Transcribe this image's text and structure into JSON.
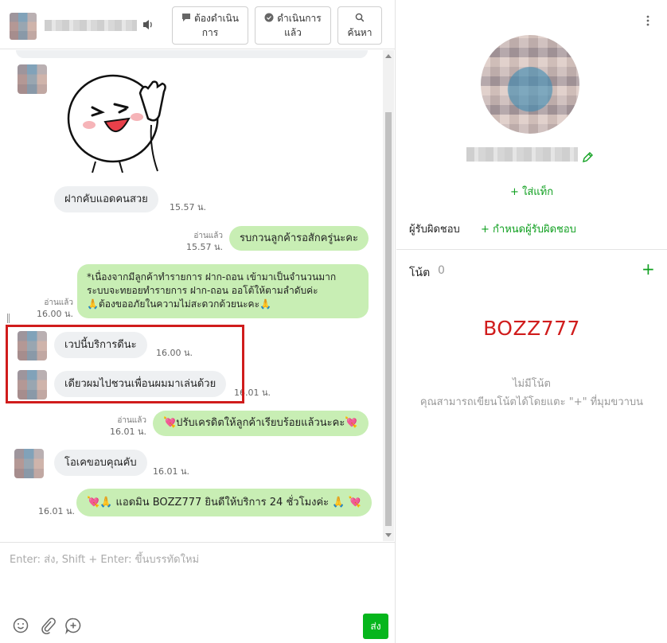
{
  "header": {
    "pending_label": "ต้องดำเนินการ",
    "done_label": "ดำเนินการแล้ว",
    "search_label": "ค้นหา"
  },
  "messages": {
    "m1": {
      "text": "ฝากคับแอดคนสวย",
      "time": "15.57 น."
    },
    "m2": {
      "text": "รบกวนลูกค้ารอสักครู่นะคะ",
      "read": "อ่านแล้ว",
      "time": "15.57 น."
    },
    "m3": {
      "line1": "*เนื่องจากมีลูกค้าทำรายการ  ฝาก-ถอน เข้ามาเป็นจำนวนมาก",
      "line2": "ระบบจะทยอยทำรายการ  ฝาก-ถอน ออโต้ให้ตามลำดับค่ะ",
      "line3": "🙏ต้องขออภัยในความไม่สะดวกด้วยนะคะ🙏",
      "read": "อ่านแล้ว",
      "time": "16.00 น."
    },
    "m4": {
      "text": "เวปนี้บริการดีนะ",
      "time": "16.00 น."
    },
    "m5": {
      "text": "เดียวผมไปชวนเพื่อนผมมาเล่นด้วย",
      "time": "16.01 น."
    },
    "m6": {
      "text": "💘ปรับเครดิตให้ลูกค้าเรียบร้อยแล้วนะคะ💘",
      "read": "อ่านแล้ว",
      "time": "16.01 น."
    },
    "m7": {
      "text": "โอเคขอบคุณคับ",
      "time": "16.01 น."
    },
    "m8": {
      "text": "💘🙏  แอดมิน BOZZ777 ยินดีให้บริการ 24 ชั่วโมงค่ะ 🙏 💘",
      "time": "16.01 น."
    }
  },
  "composer": {
    "placeholder": "Enter: ส่ง, Shift + Enter: ขึ้นบรรทัดใหม่",
    "send_label": "ส่ง"
  },
  "profile": {
    "add_tag": "+ ใส่แท็ก",
    "assignee_label": "ผู้รับผิดชอบ",
    "assign_link": "+ กำหนดผู้รับผิดชอบ",
    "notes_label": "โน้ต",
    "notes_count": "0",
    "add_note": "+",
    "brand": "BOZZ777",
    "no_notes": "ไม่มีโน้ต",
    "no_notes_hint": "คุณสามารถเขียนโน้ตได้โดยแตะ \"+\" ที่มุมขวาบน"
  },
  "colors": {
    "accent": "#06b61c",
    "outgoing_bubble": "#c8eeb4",
    "incoming_bubble": "#eef0f2",
    "highlight": "#d01c1c"
  }
}
